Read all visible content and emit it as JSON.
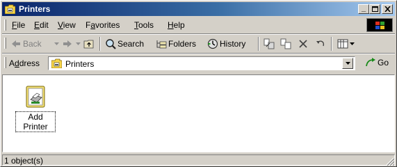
{
  "window": {
    "title": "Printers"
  },
  "menu": [
    {
      "label": "File",
      "key": "F",
      "rest": "ile"
    },
    {
      "label": "Edit",
      "key": "E",
      "rest": "dit"
    },
    {
      "label": "View",
      "key": "V",
      "rest": "iew"
    },
    {
      "label": "Favorites",
      "pre": "F",
      "key": "a",
      "rest": "vorites"
    },
    {
      "label": "Tools",
      "key": "T",
      "rest": "ools"
    },
    {
      "label": "Help",
      "key": "H",
      "rest": "elp"
    }
  ],
  "toolbar": {
    "back_label": "Back",
    "search_label": "Search",
    "folders_label": "Folders",
    "history_label": "History"
  },
  "address": {
    "label_pre": "A",
    "label_key": "d",
    "label_rest": "dress",
    "value": "Printers",
    "go_label": "Go"
  },
  "items": [
    {
      "label": "Add Printer",
      "icon": "add-printer-icon"
    }
  ],
  "status": {
    "text": "1 object(s)"
  },
  "colors": {
    "titlebar_start": "#0a246a",
    "titlebar_end": "#a6caf0",
    "face": "#d4d0c8"
  }
}
